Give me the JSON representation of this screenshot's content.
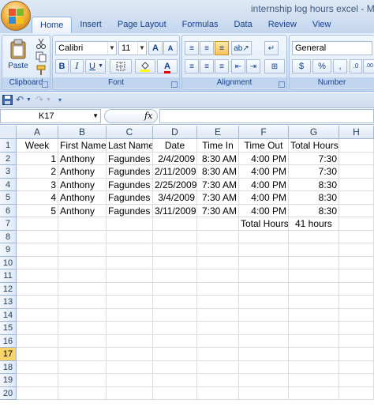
{
  "window": {
    "title": "internship log hours excel - Mic"
  },
  "tabs": [
    {
      "label": "Home",
      "active": true
    },
    {
      "label": "Insert"
    },
    {
      "label": "Page Layout"
    },
    {
      "label": "Formulas"
    },
    {
      "label": "Data"
    },
    {
      "label": "Review"
    },
    {
      "label": "View"
    }
  ],
  "ribbon": {
    "clipboard": {
      "label": "Clipboard",
      "paste_label": "Paste"
    },
    "font": {
      "label": "Font",
      "font_name": "Calibri",
      "font_size": "11",
      "grow": "A",
      "shrink": "A",
      "bold": "B",
      "italic": "I",
      "underline": "U",
      "font_color_letter": "A"
    },
    "alignment": {
      "label": "Alignment"
    },
    "number": {
      "label": "Number",
      "format": "General",
      "currency": "$",
      "percent": "%",
      "comma": ",",
      "increase_decimal": ".0",
      "decrease_decimal": ".00"
    }
  },
  "formula_bar": {
    "name_box": "K17",
    "fx": "fx"
  },
  "columns": [
    "A",
    "B",
    "C",
    "D",
    "E",
    "F",
    "G",
    "H"
  ],
  "rows": [
    "1",
    "2",
    "3",
    "4",
    "5",
    "6",
    "7",
    "8",
    "9",
    "10",
    "11",
    "12",
    "13",
    "14",
    "15",
    "16",
    "17",
    "18",
    "19",
    "20"
  ],
  "selected_row": "17",
  "cells": {
    "r1": [
      "Week",
      "First Name",
      "Last Name",
      "Date",
      "Time In",
      "Time Out",
      "Total Hours",
      ""
    ],
    "r2": [
      "1",
      "Anthony",
      "Fagundes",
      "2/4/2009",
      "8:30 AM",
      "4:00 PM",
      "7:30",
      ""
    ],
    "r3": [
      "2",
      "Anthony",
      "Fagundes",
      "2/11/2009",
      "8:30 AM",
      "4:00 PM",
      "7:30",
      ""
    ],
    "r4": [
      "3",
      "Anthony",
      "Fagundes",
      "2/25/2009",
      "7:30 AM",
      "4:00 PM",
      "8:30",
      ""
    ],
    "r5": [
      "4",
      "Anthony",
      "Fagundes",
      "3/4/2009",
      "7:30 AM",
      "4:00 PM",
      "8:30",
      ""
    ],
    "r6": [
      "5",
      "Anthony",
      "Fagundes",
      "3/11/2009",
      "7:30 AM",
      "4:00 PM",
      "8:30",
      ""
    ],
    "r7": [
      "",
      "",
      "",
      "",
      "",
      "Total Hours",
      "41 hours",
      ""
    ]
  }
}
